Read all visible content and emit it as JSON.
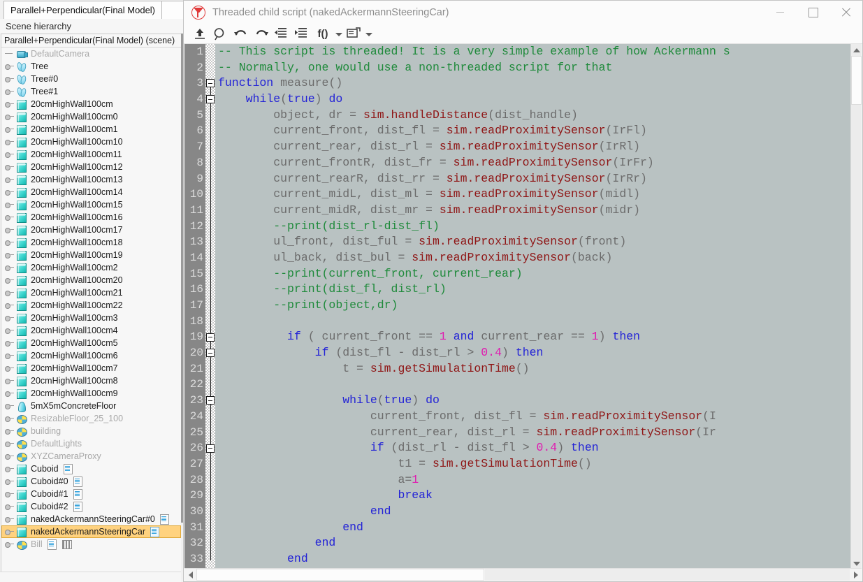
{
  "scene_panel": {
    "tab_label": "Parallel+Perpendicular(Final Model)",
    "section_label": "Scene hierarchy",
    "root_label": "Parallel+Perpendicular(Final Model) (scene)",
    "items": [
      {
        "label": "DefaultCamera",
        "icon": "camera-icon",
        "dim": true,
        "twisty": "emdash",
        "badges": []
      },
      {
        "label": "Tree",
        "icon": "tree-icon",
        "dim": false,
        "twisty": "knob",
        "badges": []
      },
      {
        "label": "Tree#0",
        "icon": "tree-icon",
        "dim": false,
        "twisty": "knob",
        "badges": []
      },
      {
        "label": "Tree#1",
        "icon": "tree-icon",
        "dim": false,
        "twisty": "knob",
        "badges": []
      },
      {
        "label": "20cmHighWall100cm",
        "icon": "cube-icon",
        "dim": false,
        "twisty": "knob",
        "badges": []
      },
      {
        "label": "20cmHighWall100cm0",
        "icon": "cube-icon",
        "dim": false,
        "twisty": "knob",
        "badges": []
      },
      {
        "label": "20cmHighWall100cm1",
        "icon": "cube-icon",
        "dim": false,
        "twisty": "knob",
        "badges": []
      },
      {
        "label": "20cmHighWall100cm10",
        "icon": "cube-icon",
        "dim": false,
        "twisty": "knob",
        "badges": []
      },
      {
        "label": "20cmHighWall100cm11",
        "icon": "cube-icon",
        "dim": false,
        "twisty": "knob",
        "badges": []
      },
      {
        "label": "20cmHighWall100cm12",
        "icon": "cube-icon",
        "dim": false,
        "twisty": "knob",
        "badges": []
      },
      {
        "label": "20cmHighWall100cm13",
        "icon": "cube-icon",
        "dim": false,
        "twisty": "knob",
        "badges": []
      },
      {
        "label": "20cmHighWall100cm14",
        "icon": "cube-icon",
        "dim": false,
        "twisty": "knob",
        "badges": []
      },
      {
        "label": "20cmHighWall100cm15",
        "icon": "cube-icon",
        "dim": false,
        "twisty": "knob",
        "badges": []
      },
      {
        "label": "20cmHighWall100cm16",
        "icon": "cube-icon",
        "dim": false,
        "twisty": "knob",
        "badges": []
      },
      {
        "label": "20cmHighWall100cm17",
        "icon": "cube-icon",
        "dim": false,
        "twisty": "knob",
        "badges": []
      },
      {
        "label": "20cmHighWall100cm18",
        "icon": "cube-icon",
        "dim": false,
        "twisty": "knob",
        "badges": []
      },
      {
        "label": "20cmHighWall100cm19",
        "icon": "cube-icon",
        "dim": false,
        "twisty": "knob",
        "badges": []
      },
      {
        "label": "20cmHighWall100cm2",
        "icon": "cube-icon",
        "dim": false,
        "twisty": "knob",
        "badges": []
      },
      {
        "label": "20cmHighWall100cm20",
        "icon": "cube-icon",
        "dim": false,
        "twisty": "knob",
        "badges": []
      },
      {
        "label": "20cmHighWall100cm21",
        "icon": "cube-icon",
        "dim": false,
        "twisty": "knob",
        "badges": []
      },
      {
        "label": "20cmHighWall100cm22",
        "icon": "cube-icon",
        "dim": false,
        "twisty": "knob",
        "badges": []
      },
      {
        "label": "20cmHighWall100cm3",
        "icon": "cube-icon",
        "dim": false,
        "twisty": "knob",
        "badges": []
      },
      {
        "label": "20cmHighWall100cm4",
        "icon": "cube-icon",
        "dim": false,
        "twisty": "knob",
        "badges": []
      },
      {
        "label": "20cmHighWall100cm5",
        "icon": "cube-icon",
        "dim": false,
        "twisty": "knob",
        "badges": []
      },
      {
        "label": "20cmHighWall100cm6",
        "icon": "cube-icon",
        "dim": false,
        "twisty": "knob",
        "badges": []
      },
      {
        "label": "20cmHighWall100cm7",
        "icon": "cube-icon",
        "dim": false,
        "twisty": "knob",
        "badges": []
      },
      {
        "label": "20cmHighWall100cm8",
        "icon": "cube-icon",
        "dim": false,
        "twisty": "knob",
        "badges": []
      },
      {
        "label": "20cmHighWall100cm9",
        "icon": "cube-icon",
        "dim": false,
        "twisty": "knob",
        "badges": []
      },
      {
        "label": "5mX5mConcreteFloor",
        "icon": "cone-icon",
        "dim": false,
        "twisty": "knob",
        "badges": []
      },
      {
        "label": "ResizableFloor_25_100",
        "icon": "disc-icon",
        "dim": true,
        "twisty": "knob",
        "badges": []
      },
      {
        "label": "building",
        "icon": "disc-icon",
        "dim": true,
        "twisty": "knob",
        "badges": []
      },
      {
        "label": "DefaultLights",
        "icon": "disc-icon",
        "dim": true,
        "twisty": "knob",
        "badges": []
      },
      {
        "label": "XYZCameraProxy",
        "icon": "disc-icon",
        "dim": true,
        "twisty": "knob",
        "badges": []
      },
      {
        "label": "Cuboid",
        "icon": "cube-icon",
        "dim": false,
        "twisty": "knob",
        "badges": [
          "script-badge"
        ]
      },
      {
        "label": "Cuboid#0",
        "icon": "cube-icon",
        "dim": false,
        "twisty": "knob",
        "badges": [
          "script-badge"
        ]
      },
      {
        "label": "Cuboid#1",
        "icon": "cube-icon",
        "dim": false,
        "twisty": "knob",
        "badges": [
          "script-badge"
        ]
      },
      {
        "label": "Cuboid#2",
        "icon": "cube-icon",
        "dim": false,
        "twisty": "knob",
        "badges": [
          "script-badge"
        ]
      },
      {
        "label": "nakedAckermannSteeringCar#0",
        "icon": "cube-icon",
        "dim": false,
        "twisty": "knob",
        "badges": [
          "script-badge"
        ]
      },
      {
        "label": "nakedAckermannSteeringCar",
        "icon": "cube-icon",
        "dim": false,
        "twisty": "knob",
        "badges": [
          "script-badge"
        ],
        "selected": true
      },
      {
        "label": "Bill",
        "icon": "disc-icon",
        "dim": true,
        "twisty": "knob",
        "badges": [
          "script-badge",
          "bars-badge"
        ]
      }
    ],
    "selection_color": "#ffd27f"
  },
  "script_window": {
    "title": "Threaded child script (nakedAckermannSteeringCar)",
    "window_buttons": {
      "minimize": "minimize-icon",
      "maximize": "maximize-icon",
      "close": "close-icon"
    },
    "toolbar": [
      {
        "name": "upload-icon",
        "label": ""
      },
      {
        "name": "search-icon",
        "label": ""
      },
      {
        "name": "undo-icon",
        "label": ""
      },
      {
        "name": "redo-icon",
        "label": ""
      },
      {
        "name": "unindent-icon",
        "label": ""
      },
      {
        "name": "indent-icon",
        "label": ""
      },
      {
        "name": "functions-icon",
        "label": "f()"
      },
      {
        "name": "functions-caret-icon",
        "label": ""
      },
      {
        "name": "snippets-icon",
        "label": ""
      },
      {
        "name": "snippets-caret-icon",
        "label": ""
      }
    ],
    "editor": {
      "first_visible_line": 1,
      "last_visible_line": 33,
      "fold_marker_lines": [
        3,
        4,
        19,
        20,
        23,
        26
      ],
      "lines": [
        {
          "n": 1,
          "tokens": [
            {
              "t": "-- This script is threaded! It is a very simple example of how Ackermann s",
              "c": "com"
            }
          ]
        },
        {
          "n": 2,
          "tokens": [
            {
              "t": "-- Normally, one would use a non-threaded script for that",
              "c": "com"
            }
          ]
        },
        {
          "n": 3,
          "tokens": [
            {
              "t": "function",
              "c": "kw"
            },
            {
              "t": " measure()",
              "c": "txt"
            }
          ]
        },
        {
          "n": 4,
          "tokens": [
            {
              "t": "    ",
              "c": "txt"
            },
            {
              "t": "while",
              "c": "kw"
            },
            {
              "t": "(",
              "c": "txt"
            },
            {
              "t": "true",
              "c": "kw"
            },
            {
              "t": ") ",
              "c": "txt"
            },
            {
              "t": "do",
              "c": "kw"
            }
          ]
        },
        {
          "n": 5,
          "tokens": [
            {
              "t": "        object, dr = ",
              "c": "txt"
            },
            {
              "t": "sim.handleDistance",
              "c": "fn"
            },
            {
              "t": "(dist_handle)",
              "c": "txt"
            }
          ]
        },
        {
          "n": 6,
          "tokens": [
            {
              "t": "        current_front, dist_fl = ",
              "c": "txt"
            },
            {
              "t": "sim.readProximitySensor",
              "c": "fn"
            },
            {
              "t": "(IrFl)",
              "c": "txt"
            }
          ]
        },
        {
          "n": 7,
          "tokens": [
            {
              "t": "        current_rear, dist_rl = ",
              "c": "txt"
            },
            {
              "t": "sim.readProximitySensor",
              "c": "fn"
            },
            {
              "t": "(IrRl)",
              "c": "txt"
            }
          ]
        },
        {
          "n": 8,
          "tokens": [
            {
              "t": "        current_frontR, dist_fr = ",
              "c": "txt"
            },
            {
              "t": "sim.readProximitySensor",
              "c": "fn"
            },
            {
              "t": "(IrFr)",
              "c": "txt"
            }
          ]
        },
        {
          "n": 9,
          "tokens": [
            {
              "t": "        current_rearR, dist_rr = ",
              "c": "txt"
            },
            {
              "t": "sim.readProximitySensor",
              "c": "fn"
            },
            {
              "t": "(IrRr)",
              "c": "txt"
            }
          ]
        },
        {
          "n": 10,
          "tokens": [
            {
              "t": "        current_midL, dist_ml = ",
              "c": "txt"
            },
            {
              "t": "sim.readProximitySensor",
              "c": "fn"
            },
            {
              "t": "(midl)",
              "c": "txt"
            }
          ]
        },
        {
          "n": 11,
          "tokens": [
            {
              "t": "        current_midR, dist_mr = ",
              "c": "txt"
            },
            {
              "t": "sim.readProximitySensor",
              "c": "fn"
            },
            {
              "t": "(midr)",
              "c": "txt"
            }
          ]
        },
        {
          "n": 12,
          "tokens": [
            {
              "t": "        --print(dist_rl-dist_fl)",
              "c": "com"
            }
          ]
        },
        {
          "n": 13,
          "tokens": [
            {
              "t": "        ul_front, dist_ful = ",
              "c": "txt"
            },
            {
              "t": "sim.readProximitySensor",
              "c": "fn"
            },
            {
              "t": "(front)",
              "c": "txt"
            }
          ]
        },
        {
          "n": 14,
          "tokens": [
            {
              "t": "        ul_back, dist_bul = ",
              "c": "txt"
            },
            {
              "t": "sim.readProximitySensor",
              "c": "fn"
            },
            {
              "t": "(back)",
              "c": "txt"
            }
          ]
        },
        {
          "n": 15,
          "tokens": [
            {
              "t": "        --print(current_front, current_rear)",
              "c": "com"
            }
          ]
        },
        {
          "n": 16,
          "tokens": [
            {
              "t": "        --print(dist_fl, dist_rl)",
              "c": "com"
            }
          ]
        },
        {
          "n": 17,
          "tokens": [
            {
              "t": "        --print(object,dr)",
              "c": "com"
            }
          ]
        },
        {
          "n": 18,
          "tokens": [
            {
              "t": "",
              "c": "txt"
            }
          ]
        },
        {
          "n": 19,
          "tokens": [
            {
              "t": "          ",
              "c": "txt"
            },
            {
              "t": "if",
              "c": "kw"
            },
            {
              "t": " ( current_front == ",
              "c": "txt"
            },
            {
              "t": "1",
              "c": "num"
            },
            {
              "t": " ",
              "c": "txt"
            },
            {
              "t": "and",
              "c": "kw"
            },
            {
              "t": " current_rear == ",
              "c": "txt"
            },
            {
              "t": "1",
              "c": "num"
            },
            {
              "t": ") ",
              "c": "txt"
            },
            {
              "t": "then",
              "c": "kw"
            }
          ]
        },
        {
          "n": 20,
          "tokens": [
            {
              "t": "              ",
              "c": "txt"
            },
            {
              "t": "if",
              "c": "kw"
            },
            {
              "t": " (dist_fl - dist_rl > ",
              "c": "txt"
            },
            {
              "t": "0.4",
              "c": "num"
            },
            {
              "t": ") ",
              "c": "txt"
            },
            {
              "t": "then",
              "c": "kw"
            }
          ]
        },
        {
          "n": 21,
          "tokens": [
            {
              "t": "                  t = ",
              "c": "txt"
            },
            {
              "t": "sim.getSimulationTime",
              "c": "fn"
            },
            {
              "t": "()",
              "c": "txt"
            }
          ]
        },
        {
          "n": 22,
          "tokens": [
            {
              "t": "",
              "c": "txt"
            }
          ]
        },
        {
          "n": 23,
          "tokens": [
            {
              "t": "                  ",
              "c": "txt"
            },
            {
              "t": "while",
              "c": "kw"
            },
            {
              "t": "(",
              "c": "txt"
            },
            {
              "t": "true",
              "c": "kw"
            },
            {
              "t": ") ",
              "c": "txt"
            },
            {
              "t": "do",
              "c": "kw"
            }
          ]
        },
        {
          "n": 24,
          "tokens": [
            {
              "t": "                      current_front, dist_fl = ",
              "c": "txt"
            },
            {
              "t": "sim.readProximitySensor",
              "c": "fn"
            },
            {
              "t": "(I",
              "c": "txt"
            }
          ]
        },
        {
          "n": 25,
          "tokens": [
            {
              "t": "                      current_rear, dist_rl = ",
              "c": "txt"
            },
            {
              "t": "sim.readProximitySensor",
              "c": "fn"
            },
            {
              "t": "(Ir",
              "c": "txt"
            }
          ]
        },
        {
          "n": 26,
          "tokens": [
            {
              "t": "                      ",
              "c": "txt"
            },
            {
              "t": "if",
              "c": "kw"
            },
            {
              "t": " (dist_rl - dist_fl > ",
              "c": "txt"
            },
            {
              "t": "0.4",
              "c": "num"
            },
            {
              "t": ") ",
              "c": "txt"
            },
            {
              "t": "then",
              "c": "kw"
            }
          ]
        },
        {
          "n": 27,
          "tokens": [
            {
              "t": "                          t1 = ",
              "c": "txt"
            },
            {
              "t": "sim.getSimulationTime",
              "c": "fn"
            },
            {
              "t": "()",
              "c": "txt"
            }
          ]
        },
        {
          "n": 28,
          "tokens": [
            {
              "t": "                          a=",
              "c": "txt"
            },
            {
              "t": "1",
              "c": "num"
            }
          ]
        },
        {
          "n": 29,
          "tokens": [
            {
              "t": "                          ",
              "c": "txt"
            },
            {
              "t": "break",
              "c": "kw"
            }
          ]
        },
        {
          "n": 30,
          "tokens": [
            {
              "t": "                      ",
              "c": "txt"
            },
            {
              "t": "end",
              "c": "kw"
            }
          ]
        },
        {
          "n": 31,
          "tokens": [
            {
              "t": "                  ",
              "c": "txt"
            },
            {
              "t": "end",
              "c": "kw"
            }
          ]
        },
        {
          "n": 32,
          "tokens": [
            {
              "t": "              ",
              "c": "txt"
            },
            {
              "t": "end",
              "c": "kw"
            }
          ]
        },
        {
          "n": 33,
          "tokens": [
            {
              "t": "          ",
              "c": "txt"
            },
            {
              "t": "end",
              "c": "kw"
            }
          ]
        }
      ]
    },
    "colors": {
      "editor_background": "#b9c2c2",
      "gutter_background": "#878787",
      "comment": "#1f8a3b",
      "keyword": "#2323d6",
      "function": "#8f1616",
      "number": "#e01ab0",
      "text": "#6b6b6b"
    }
  }
}
